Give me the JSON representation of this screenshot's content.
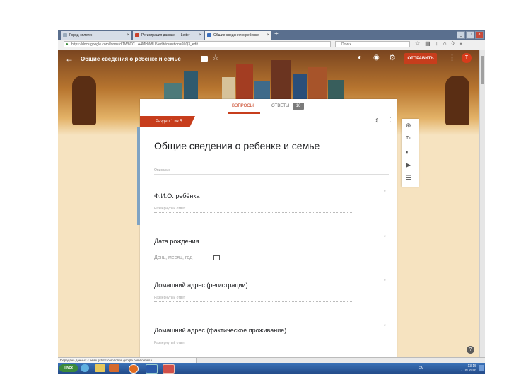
{
  "browser": {
    "tabs": [
      {
        "label": "Город-сплетен",
        "active": false,
        "color": "#5a6f8e"
      },
      {
        "label": "Регистрация данных — Letter",
        "active": false,
        "color": "#c8402b"
      },
      {
        "label": "Общие сведения о ребенке",
        "active": true,
        "color": "#3a6fbf"
      }
    ],
    "new_tab": "+",
    "url": "https://docs.google.com/forms/d/1W8CC...A4MHW8U5/edit#question=9LQ3_edit",
    "search_placeholder": "Поиск",
    "window_controls": [
      "_",
      "□",
      "×"
    ]
  },
  "header": {
    "back": "←",
    "title": "Общие сведения о ребенке и семье",
    "send_label": "ОТПРАВИТЬ",
    "avatar_letter": "Т",
    "colors": {
      "accent": "#c73d1c",
      "banner": "#b7752f"
    }
  },
  "form": {
    "tabs": {
      "questions": "ВОПРОСЫ",
      "answers": "ОТВЕТЫ",
      "answers_count": "16"
    },
    "section_label": "Раздел 1 из 5",
    "section_title": "Общие сведения о ребенке и семье",
    "description_placeholder": "Описание",
    "questions": [
      {
        "label": "Ф.И.О. ребёнка",
        "placeholder": "Развернутый ответ",
        "required_mark": "*"
      },
      {
        "label": "Дата рождения",
        "placeholder": "День, месяц, год",
        "required_mark": "*"
      },
      {
        "label": "Домашний адрес (регистрации)",
        "placeholder": "Развернутый ответ",
        "required_mark": "*"
      },
      {
        "label": "Домашний адрес (фактическое проживание)",
        "placeholder": "Развернутый ответ",
        "required_mark": "*"
      }
    ]
  },
  "sidebar": {
    "add": "⊕",
    "title": "Tт"
  },
  "status_bar": {
    "text": "Передача данных с www.gstatic.com/forms.google.com/forms/ui..."
  },
  "taskbar": {
    "start": "Пуск",
    "lang": "EN",
    "time": "13:15",
    "date": "17.09.2016"
  }
}
